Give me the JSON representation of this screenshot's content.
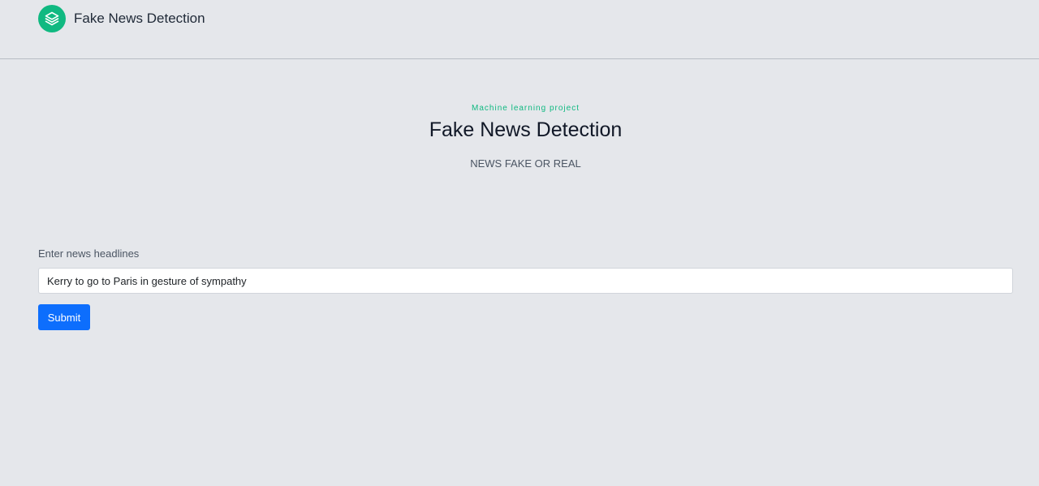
{
  "header": {
    "logo_icon": "layers-icon",
    "brand_color": "#10b981",
    "title": "Fake News Detection"
  },
  "hero": {
    "eyebrow": "Machine learning project",
    "title": "Fake News Detection",
    "subtitle": "NEWS FAKE OR REAL"
  },
  "form": {
    "label": "Enter news headlines",
    "input_value": "Kerry to go to Paris in gesture of sympathy",
    "submit_label": "Submit",
    "submit_color": "#0d6efd"
  }
}
